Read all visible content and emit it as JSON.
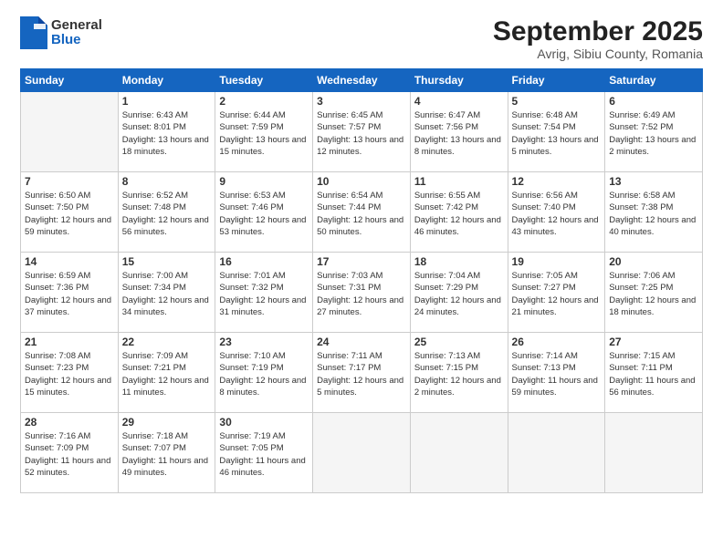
{
  "logo": {
    "general": "General",
    "blue": "Blue"
  },
  "header": {
    "month": "September 2025",
    "location": "Avrig, Sibiu County, Romania"
  },
  "weekdays": [
    "Sunday",
    "Monday",
    "Tuesday",
    "Wednesday",
    "Thursday",
    "Friday",
    "Saturday"
  ],
  "weeks": [
    [
      {
        "day": "",
        "empty": true
      },
      {
        "day": "1",
        "sunrise": "6:43 AM",
        "sunset": "8:01 PM",
        "daylight": "13 hours and 18 minutes."
      },
      {
        "day": "2",
        "sunrise": "6:44 AM",
        "sunset": "7:59 PM",
        "daylight": "13 hours and 15 minutes."
      },
      {
        "day": "3",
        "sunrise": "6:45 AM",
        "sunset": "7:57 PM",
        "daylight": "13 hours and 12 minutes."
      },
      {
        "day": "4",
        "sunrise": "6:47 AM",
        "sunset": "7:56 PM",
        "daylight": "13 hours and 8 minutes."
      },
      {
        "day": "5",
        "sunrise": "6:48 AM",
        "sunset": "7:54 PM",
        "daylight": "13 hours and 5 minutes."
      },
      {
        "day": "6",
        "sunrise": "6:49 AM",
        "sunset": "7:52 PM",
        "daylight": "13 hours and 2 minutes."
      }
    ],
    [
      {
        "day": "7",
        "sunrise": "6:50 AM",
        "sunset": "7:50 PM",
        "daylight": "12 hours and 59 minutes."
      },
      {
        "day": "8",
        "sunrise": "6:52 AM",
        "sunset": "7:48 PM",
        "daylight": "12 hours and 56 minutes."
      },
      {
        "day": "9",
        "sunrise": "6:53 AM",
        "sunset": "7:46 PM",
        "daylight": "12 hours and 53 minutes."
      },
      {
        "day": "10",
        "sunrise": "6:54 AM",
        "sunset": "7:44 PM",
        "daylight": "12 hours and 50 minutes."
      },
      {
        "day": "11",
        "sunrise": "6:55 AM",
        "sunset": "7:42 PM",
        "daylight": "12 hours and 46 minutes."
      },
      {
        "day": "12",
        "sunrise": "6:56 AM",
        "sunset": "7:40 PM",
        "daylight": "12 hours and 43 minutes."
      },
      {
        "day": "13",
        "sunrise": "6:58 AM",
        "sunset": "7:38 PM",
        "daylight": "12 hours and 40 minutes."
      }
    ],
    [
      {
        "day": "14",
        "sunrise": "6:59 AM",
        "sunset": "7:36 PM",
        "daylight": "12 hours and 37 minutes."
      },
      {
        "day": "15",
        "sunrise": "7:00 AM",
        "sunset": "7:34 PM",
        "daylight": "12 hours and 34 minutes."
      },
      {
        "day": "16",
        "sunrise": "7:01 AM",
        "sunset": "7:32 PM",
        "daylight": "12 hours and 31 minutes."
      },
      {
        "day": "17",
        "sunrise": "7:03 AM",
        "sunset": "7:31 PM",
        "daylight": "12 hours and 27 minutes."
      },
      {
        "day": "18",
        "sunrise": "7:04 AM",
        "sunset": "7:29 PM",
        "daylight": "12 hours and 24 minutes."
      },
      {
        "day": "19",
        "sunrise": "7:05 AM",
        "sunset": "7:27 PM",
        "daylight": "12 hours and 21 minutes."
      },
      {
        "day": "20",
        "sunrise": "7:06 AM",
        "sunset": "7:25 PM",
        "daylight": "12 hours and 18 minutes."
      }
    ],
    [
      {
        "day": "21",
        "sunrise": "7:08 AM",
        "sunset": "7:23 PM",
        "daylight": "12 hours and 15 minutes."
      },
      {
        "day": "22",
        "sunrise": "7:09 AM",
        "sunset": "7:21 PM",
        "daylight": "12 hours and 11 minutes."
      },
      {
        "day": "23",
        "sunrise": "7:10 AM",
        "sunset": "7:19 PM",
        "daylight": "12 hours and 8 minutes."
      },
      {
        "day": "24",
        "sunrise": "7:11 AM",
        "sunset": "7:17 PM",
        "daylight": "12 hours and 5 minutes."
      },
      {
        "day": "25",
        "sunrise": "7:13 AM",
        "sunset": "7:15 PM",
        "daylight": "12 hours and 2 minutes."
      },
      {
        "day": "26",
        "sunrise": "7:14 AM",
        "sunset": "7:13 PM",
        "daylight": "11 hours and 59 minutes."
      },
      {
        "day": "27",
        "sunrise": "7:15 AM",
        "sunset": "7:11 PM",
        "daylight": "11 hours and 56 minutes."
      }
    ],
    [
      {
        "day": "28",
        "sunrise": "7:16 AM",
        "sunset": "7:09 PM",
        "daylight": "11 hours and 52 minutes."
      },
      {
        "day": "29",
        "sunrise": "7:18 AM",
        "sunset": "7:07 PM",
        "daylight": "11 hours and 49 minutes."
      },
      {
        "day": "30",
        "sunrise": "7:19 AM",
        "sunset": "7:05 PM",
        "daylight": "11 hours and 46 minutes."
      },
      {
        "day": "",
        "empty": true
      },
      {
        "day": "",
        "empty": true
      },
      {
        "day": "",
        "empty": true
      },
      {
        "day": "",
        "empty": true
      }
    ]
  ]
}
